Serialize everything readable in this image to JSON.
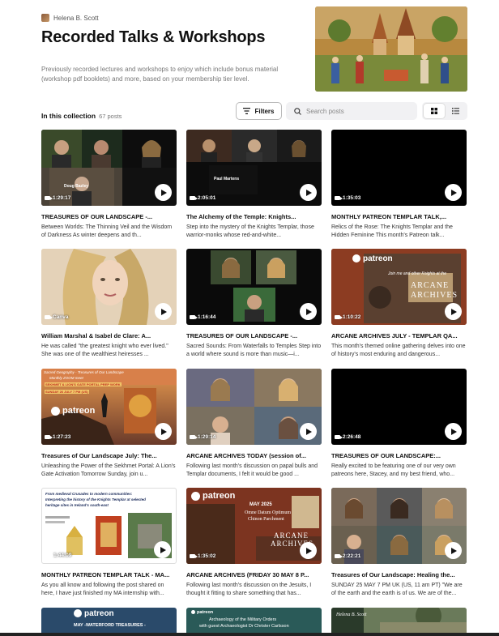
{
  "creator": {
    "name": "Helena B. Scott"
  },
  "page": {
    "title": "Recorded Talks & Workshops",
    "description": "Previously recorded lectures and workshops to enjoy which include bonus material (workshop pdf booklets) and more, based on your membership tier level."
  },
  "collection": {
    "label": "In this collection",
    "count": "67 posts"
  },
  "toolbar": {
    "filters_label": "Filters",
    "search_placeholder": "Search posts"
  },
  "colors": {
    "accent": "#111111",
    "muted": "#777777",
    "search_bg": "#f1f1f3"
  },
  "posts": [
    {
      "duration": "1:29:17",
      "title": "TREASURES OF OUR LANDSCAPE -...",
      "desc": "Between Worlds: The Thinning Veil and the Wisdom of Darkness As winter deepens and th...",
      "thumb": "zoom-grid",
      "tags": [
        "Doug Bazley"
      ]
    },
    {
      "duration": "2:05:01",
      "title": "The Alchemy of the Temple: Knights...",
      "desc": "Step into the mystery of the Knights Templar, those warrior-monks whose red-and-white...",
      "thumb": "zoom-dark",
      "tags": [
        "Paul Martens"
      ]
    },
    {
      "duration": "1:35:03",
      "title": "MONTHLY PATREON TEMPLAR TALK,...",
      "desc": "Relics of the Rose: The Knights Templar and the Hidden Feminine This month's Patreon talk...",
      "thumb": "black"
    },
    {
      "duration": "Canva",
      "title": "William Marshal & Isabel de Clare: A...",
      "desc": "He was called \"the greatest knight who ever lived.\" She was one of the wealthiest heiresses ...",
      "thumb": "portrait"
    },
    {
      "duration": "1:16:44",
      "title": "TREASURES OF OUR LANDSCAPE -...",
      "desc": "Sacred Sounds: From Waterfalls to Temples Step into a world where sound is more than music—i...",
      "thumb": "zoom-three"
    },
    {
      "duration": "1:10:22",
      "title": "ARCANE ARCHIVES JULY - TEMPLAR QA...",
      "desc": "This month's themed online gathering delves into one of history's most enduring and dangerous...",
      "thumb": "patreon-arcane",
      "brand": "patreon",
      "poster_lines": [
        "Join me and other Knights at the",
        "ARCANE",
        "ARCHIVES"
      ]
    },
    {
      "duration": "1:27:23",
      "title": "Treasures of Our Landscape July: The...",
      "desc": "Unleashing the Power of the Sekhmet Portal: A Lion's Gate Activation Tomorrow Sunday, join u...",
      "thumb": "sekhmet",
      "brand": "patreon",
      "poster_lines": [
        "Sacred Geography - Treasures of Our Landscape",
        "Monthly ZOOM meet",
        "SEKHMET & LION'S GATE PORTAL PREP WORK",
        "SUNDAY 26 JULY 7 PM (US)"
      ]
    },
    {
      "duration": "1:29:14",
      "title": "ARCANE ARCHIVES TODAY (session of...",
      "desc": "Following last month's discussion on papal bulls and Templar documents, I felt it would be good ...",
      "thumb": "zoom-four"
    },
    {
      "duration": "2:26:48",
      "title": "TREASURES OF OUR LANDSCAPE:...",
      "desc": "Really excited to be featuring one of our very own patreons here, Stacey, and my best friend, who...",
      "thumb": "black"
    },
    {
      "duration": "1:44:09",
      "title": "MONTHLY PATREON TEMPLAR TALK - MA...",
      "desc": "As you all know and following the post shared on here, I have just finished my MA internship with...",
      "thumb": "slide",
      "poster_lines": [
        "From medieval Crusades to modern communities:",
        "Interpreting the history of the Knights Templar at selected",
        "heritage sites in Ireland's south-east"
      ]
    },
    {
      "duration": "1:35:02",
      "title": "ARCANE ARCHIVES (FRIDAY 30 MAY 8 P...",
      "desc": "Following last month's discussion on the Jesuits, I thought it fitting to share something that has...",
      "thumb": "patreon-may",
      "brand": "patreon",
      "poster_lines": [
        "MAY 2025",
        "Omne Datum Optimum",
        "Chinon Parchment",
        "ARCANE",
        "ARCHIVES"
      ]
    },
    {
      "duration": "2:22:21",
      "title": "Treasures of Our Landscape: Healing the...",
      "desc": "SUNDAY 25 MAY 7 PM UK (US, 11 am PT) \"We are of the earth and the earth is of us. We are of the...",
      "thumb": "zoom-six"
    }
  ],
  "partial_row": [
    {
      "brand": "patreon",
      "caption": "MAY -WATERFORD TREASURES -"
    },
    {
      "brand": "patreon",
      "caption": "Archaeology of the Military Orders",
      "caption2": "with guest Archaeologist Dr Christer Carlsson"
    },
    {
      "caption": "Helena B. Scott"
    }
  ]
}
